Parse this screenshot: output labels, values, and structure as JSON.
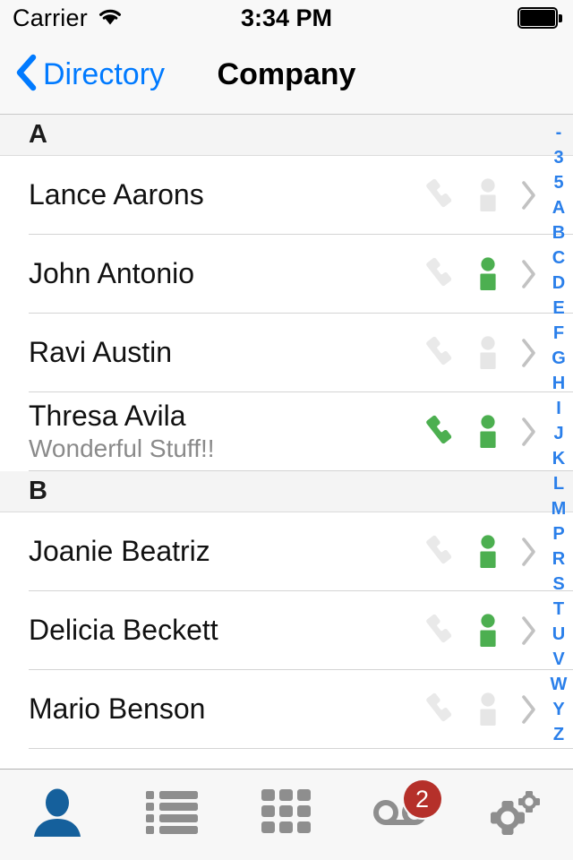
{
  "status_bar": {
    "carrier": "Carrier",
    "wifi_icon": "wifi-icon",
    "time": "3:34 PM",
    "battery_icon": "battery-full-icon"
  },
  "nav_bar": {
    "back_icon": "chevron-left-icon",
    "back_label": "Directory",
    "title": "Company"
  },
  "colors": {
    "tint_blue": "#007aff",
    "index_blue": "#2a7fea",
    "presence_available": "#4caf50",
    "presence_offline": "#e6e6e6",
    "badge_red": "#b5302a",
    "tab_active": "#15609c",
    "tab_inactive": "#8e8e8e"
  },
  "sections": [
    {
      "letter": "A",
      "rows": [
        {
          "name": "Lance Aarons",
          "subtitle": "",
          "call_icon": "phone-icon",
          "call_state": "disabled",
          "presence_icon": "presence-person-icon",
          "presence_state": "offline",
          "disclosure_icon": "chevron-right-icon"
        },
        {
          "name": "John Antonio",
          "subtitle": "",
          "call_icon": "phone-icon",
          "call_state": "disabled",
          "presence_icon": "presence-person-icon",
          "presence_state": "available",
          "disclosure_icon": "chevron-right-icon"
        },
        {
          "name": "Ravi Austin",
          "subtitle": "",
          "call_icon": "phone-icon",
          "call_state": "disabled",
          "presence_icon": "presence-person-icon",
          "presence_state": "offline",
          "disclosure_icon": "chevron-right-icon"
        },
        {
          "name": "Thresa Avila",
          "subtitle": "Wonderful Stuff!!",
          "call_icon": "phone-icon",
          "call_state": "enabled",
          "presence_icon": "presence-person-icon",
          "presence_state": "available",
          "disclosure_icon": "chevron-right-icon"
        }
      ]
    },
    {
      "letter": "B",
      "rows": [
        {
          "name": "Joanie Beatriz",
          "subtitle": "",
          "call_icon": "phone-icon",
          "call_state": "disabled",
          "presence_icon": "presence-person-icon",
          "presence_state": "available",
          "disclosure_icon": "chevron-right-icon"
        },
        {
          "name": "Delicia Beckett",
          "subtitle": "",
          "call_icon": "phone-icon",
          "call_state": "disabled",
          "presence_icon": "presence-person-icon",
          "presence_state": "available",
          "disclosure_icon": "chevron-right-icon"
        },
        {
          "name": "Mario Benson",
          "subtitle": "",
          "call_icon": "phone-icon",
          "call_state": "disabled",
          "presence_icon": "presence-person-icon",
          "presence_state": "offline",
          "disclosure_icon": "chevron-right-icon"
        }
      ]
    }
  ],
  "section_index": [
    "-",
    "3",
    "5",
    "A",
    "B",
    "C",
    "D",
    "E",
    "F",
    "G",
    "H",
    "I",
    "J",
    "K",
    "L",
    "M",
    "P",
    "R",
    "S",
    "T",
    "U",
    "V",
    "W",
    "Y",
    "Z"
  ],
  "tab_bar": {
    "tabs": [
      {
        "name": "contacts",
        "icon": "person-filled-icon",
        "active": true,
        "badge": ""
      },
      {
        "name": "history",
        "icon": "list-icon",
        "active": false,
        "badge": ""
      },
      {
        "name": "keypad",
        "icon": "grid-icon",
        "active": false,
        "badge": ""
      },
      {
        "name": "voicemail",
        "icon": "voicemail-icon",
        "active": false,
        "badge": "2"
      },
      {
        "name": "settings",
        "icon": "gears-icon",
        "active": false,
        "badge": ""
      }
    ]
  }
}
